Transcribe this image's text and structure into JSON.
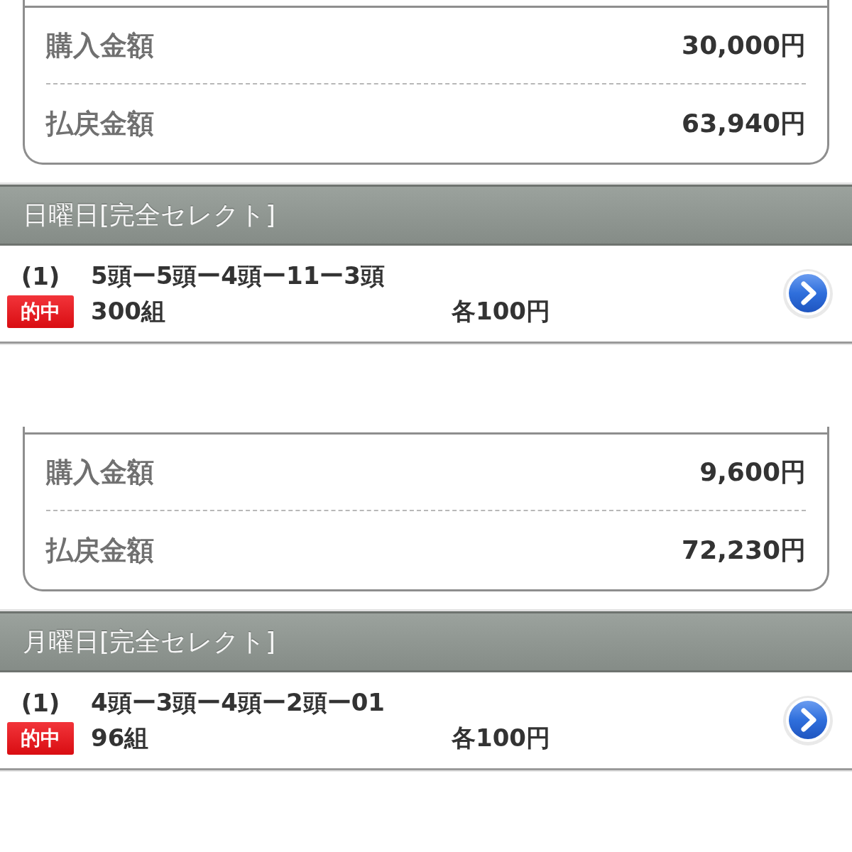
{
  "sections": [
    {
      "summary": [
        {
          "label": "購入金額",
          "value": "30,000円"
        },
        {
          "label": "払戻金額",
          "value": "63,940円"
        }
      ],
      "header": "日曜日[完全セレクト]",
      "bets": [
        {
          "number": "(1)",
          "combination": "5頭ー5頭ー4頭ー11ー3頭",
          "badge": "的中",
          "sets": "300組",
          "unit_price": "各100円"
        }
      ]
    },
    {
      "summary": [
        {
          "label": "購入金額",
          "value": "9,600円"
        },
        {
          "label": "払戻金額",
          "value": "72,230円"
        }
      ],
      "header": "月曜日[完全セレクト]",
      "bets": [
        {
          "number": "(1)",
          "combination": "4頭ー3頭ー4頭ー2頭ー01",
          "badge": "的中",
          "sets": "96組",
          "unit_price": "各100円"
        }
      ]
    }
  ]
}
